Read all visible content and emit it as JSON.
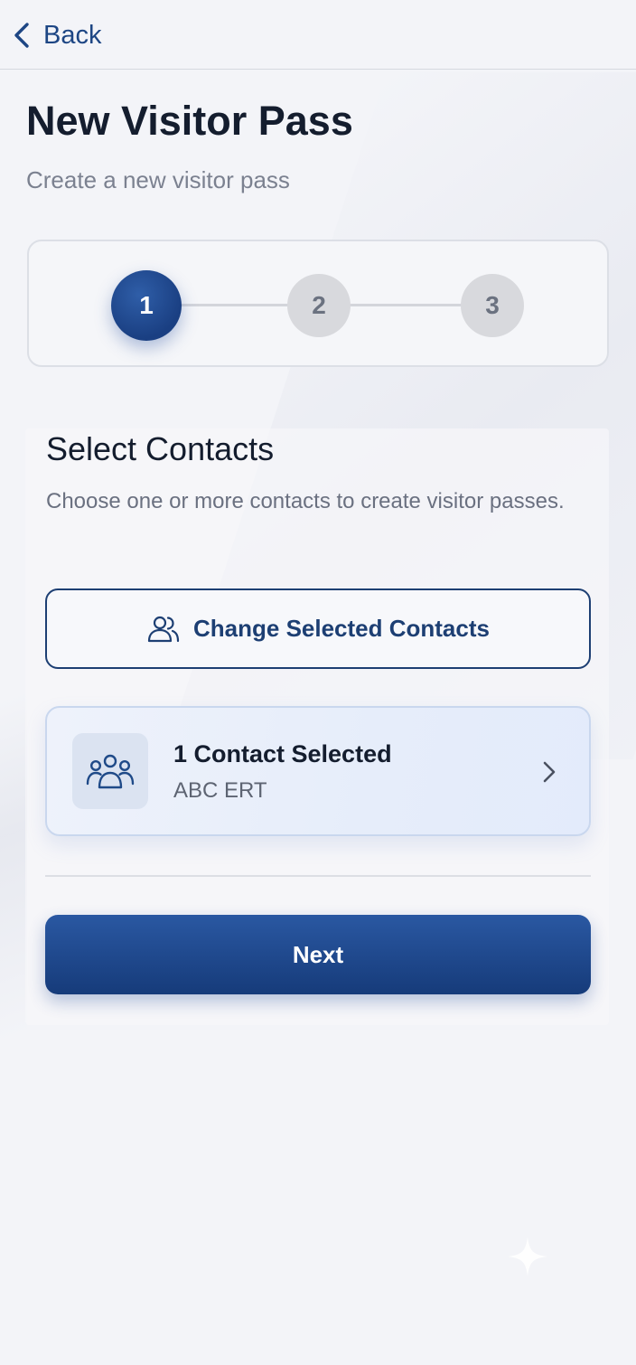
{
  "header": {
    "back_label": "Back"
  },
  "page": {
    "title": "New Visitor Pass",
    "subtitle": "Create a new visitor pass"
  },
  "stepper": {
    "steps": [
      "1",
      "2",
      "3"
    ],
    "current_step": 1
  },
  "section": {
    "title": "Select Contacts",
    "description": "Choose one or more contacts to create visitor passes."
  },
  "change_button": {
    "label": "Change Selected Contacts",
    "icon": "users-icon"
  },
  "contact_card": {
    "title": "1 Contact Selected",
    "subtitle": "ABC ERT",
    "icon": "group-icon"
  },
  "next_button": {
    "label": "Next"
  },
  "colors": {
    "primary": "#1d4684",
    "primary_dark": "#163b7a",
    "background": "#f3f4f8",
    "inactive_step": "#d8d9dd",
    "text": "#141d2e",
    "muted_text": "#7b8190"
  }
}
